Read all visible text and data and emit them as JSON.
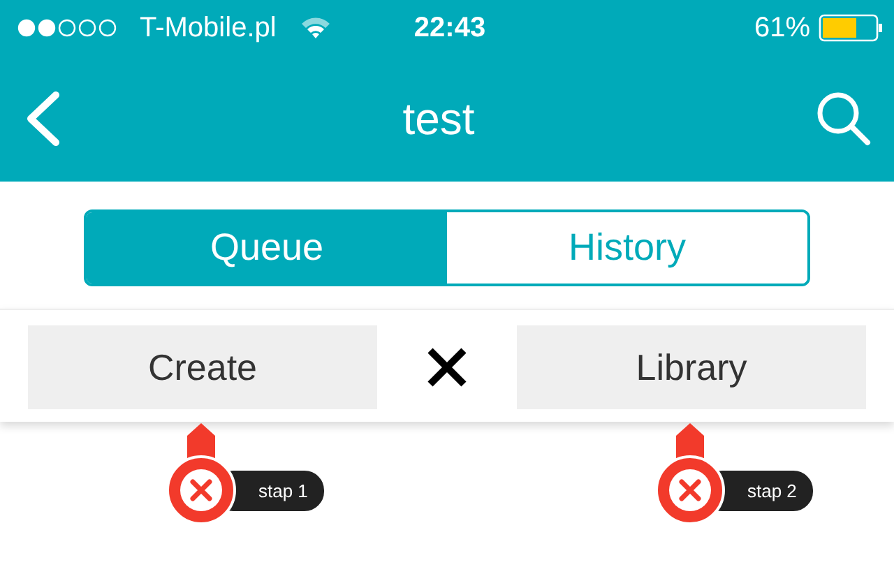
{
  "status_bar": {
    "carrier": "T-Mobile.pl",
    "time": "22:43",
    "battery": "61%"
  },
  "nav_bar": {
    "title": "test"
  },
  "tabs": [
    {
      "label": "Queue",
      "selected": true
    },
    {
      "label": "History",
      "selected": false
    }
  ],
  "actions": [
    {
      "label": "Create"
    },
    {
      "label": "Library"
    }
  ],
  "markers": [
    {
      "label": "stap 1"
    },
    {
      "label": "stap 2"
    }
  ]
}
